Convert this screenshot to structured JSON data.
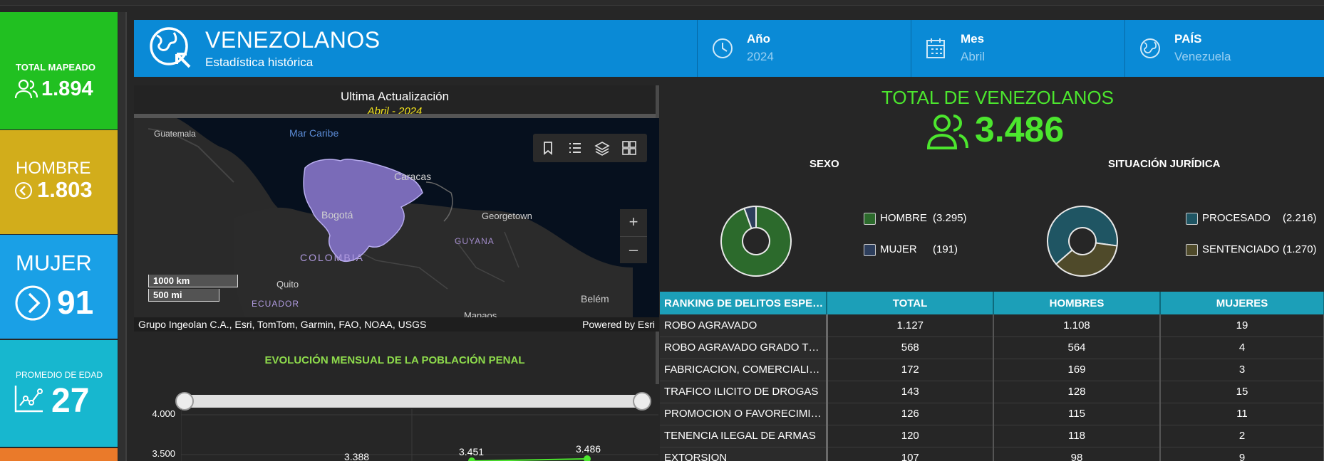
{
  "kpis": {
    "total": {
      "label": "TOTAL MAPEADO",
      "value": "1.894"
    },
    "hombre": {
      "label": "HOMBRE",
      "value": "1.803"
    },
    "mujer": {
      "label": "MUJER",
      "value": "91"
    },
    "edad": {
      "label": "PROMEDIO DE EDAD",
      "value": "27"
    }
  },
  "header": {
    "title": "VENEZOLANOS",
    "subtitle": "Estadística histórica",
    "year": {
      "label": "Año",
      "value": "2024"
    },
    "month": {
      "label": "Mes",
      "value": "Abril"
    },
    "country": {
      "label": "PAÍS",
      "value": "Venezuela"
    }
  },
  "update": {
    "label": "Ultima Actualización",
    "value": "Abril - 2024"
  },
  "map": {
    "labels": {
      "guatemala": "Guatemala",
      "caribe": "Mar Caribe",
      "caracas": "Caracas",
      "georgetown": "Georgetown",
      "bogota": "Bogotá",
      "guyana": "GUYANA",
      "colombia": "COLOMBIA",
      "quito": "Quito",
      "ecuador": "ECUADOR",
      "manaos": "Manaos",
      "belem": "Belém"
    },
    "scale_km": "1000 km",
    "scale_mi": "500 mi",
    "attribution": "Grupo Ingeolan C.A., Esri, TomTom, Garmin, FAO, NOAA, USGS",
    "powered": "Powered by Esri",
    "zoom_in": "+",
    "zoom_out": "–"
  },
  "evolution": {
    "title": "EVOLUCIÓN MENSUAL DE LA POBLACIÓN PENAL",
    "yticks": [
      "4.000",
      "3.500"
    ],
    "points": [
      "3.388",
      "3.451",
      "3.486"
    ]
  },
  "total": {
    "title": "TOTAL DE VENEZOLANOS",
    "value": "3.486"
  },
  "sexo": {
    "title": "SEXO",
    "items": [
      {
        "label": "HOMBRE",
        "count": "(3.295)",
        "value": 3295,
        "color": "#2c6a2c"
      },
      {
        "label": "MUJER",
        "count": "(191)",
        "value": 191,
        "color": "#2d3e5c"
      }
    ]
  },
  "juridica": {
    "title": "SITUACIÓN JURÍDICA",
    "items": [
      {
        "label": "PROCESADO",
        "count": "(2.216)",
        "value": 2216,
        "color": "#1f5563"
      },
      {
        "label": "SENTENCIADO",
        "count": "(1.270)",
        "value": 1270,
        "color": "#4f4a2a"
      }
    ]
  },
  "ranking": {
    "headers": [
      "RANKING DE DELITOS ESPECÍFICOS",
      "TOTAL",
      "HOMBRES",
      "MUJERES"
    ],
    "rows": [
      [
        "ROBO AGRAVADO",
        "1.127",
        "1.108",
        "19"
      ],
      [
        "ROBO AGRAVADO GRADO TENTATIVA",
        "568",
        "564",
        "4"
      ],
      [
        "FABRICACION, COMERCIALIZACION",
        "172",
        "169",
        "3"
      ],
      [
        "TRAFICO ILICITO DE DROGAS",
        "143",
        "128",
        "15"
      ],
      [
        "PROMOCION O FAVORECIMIENTO",
        "126",
        "115",
        "11"
      ],
      [
        "TENENCIA ILEGAL DE ARMAS",
        "120",
        "118",
        "2"
      ],
      [
        "EXTORSION",
        "107",
        "98",
        "9"
      ]
    ]
  }
}
